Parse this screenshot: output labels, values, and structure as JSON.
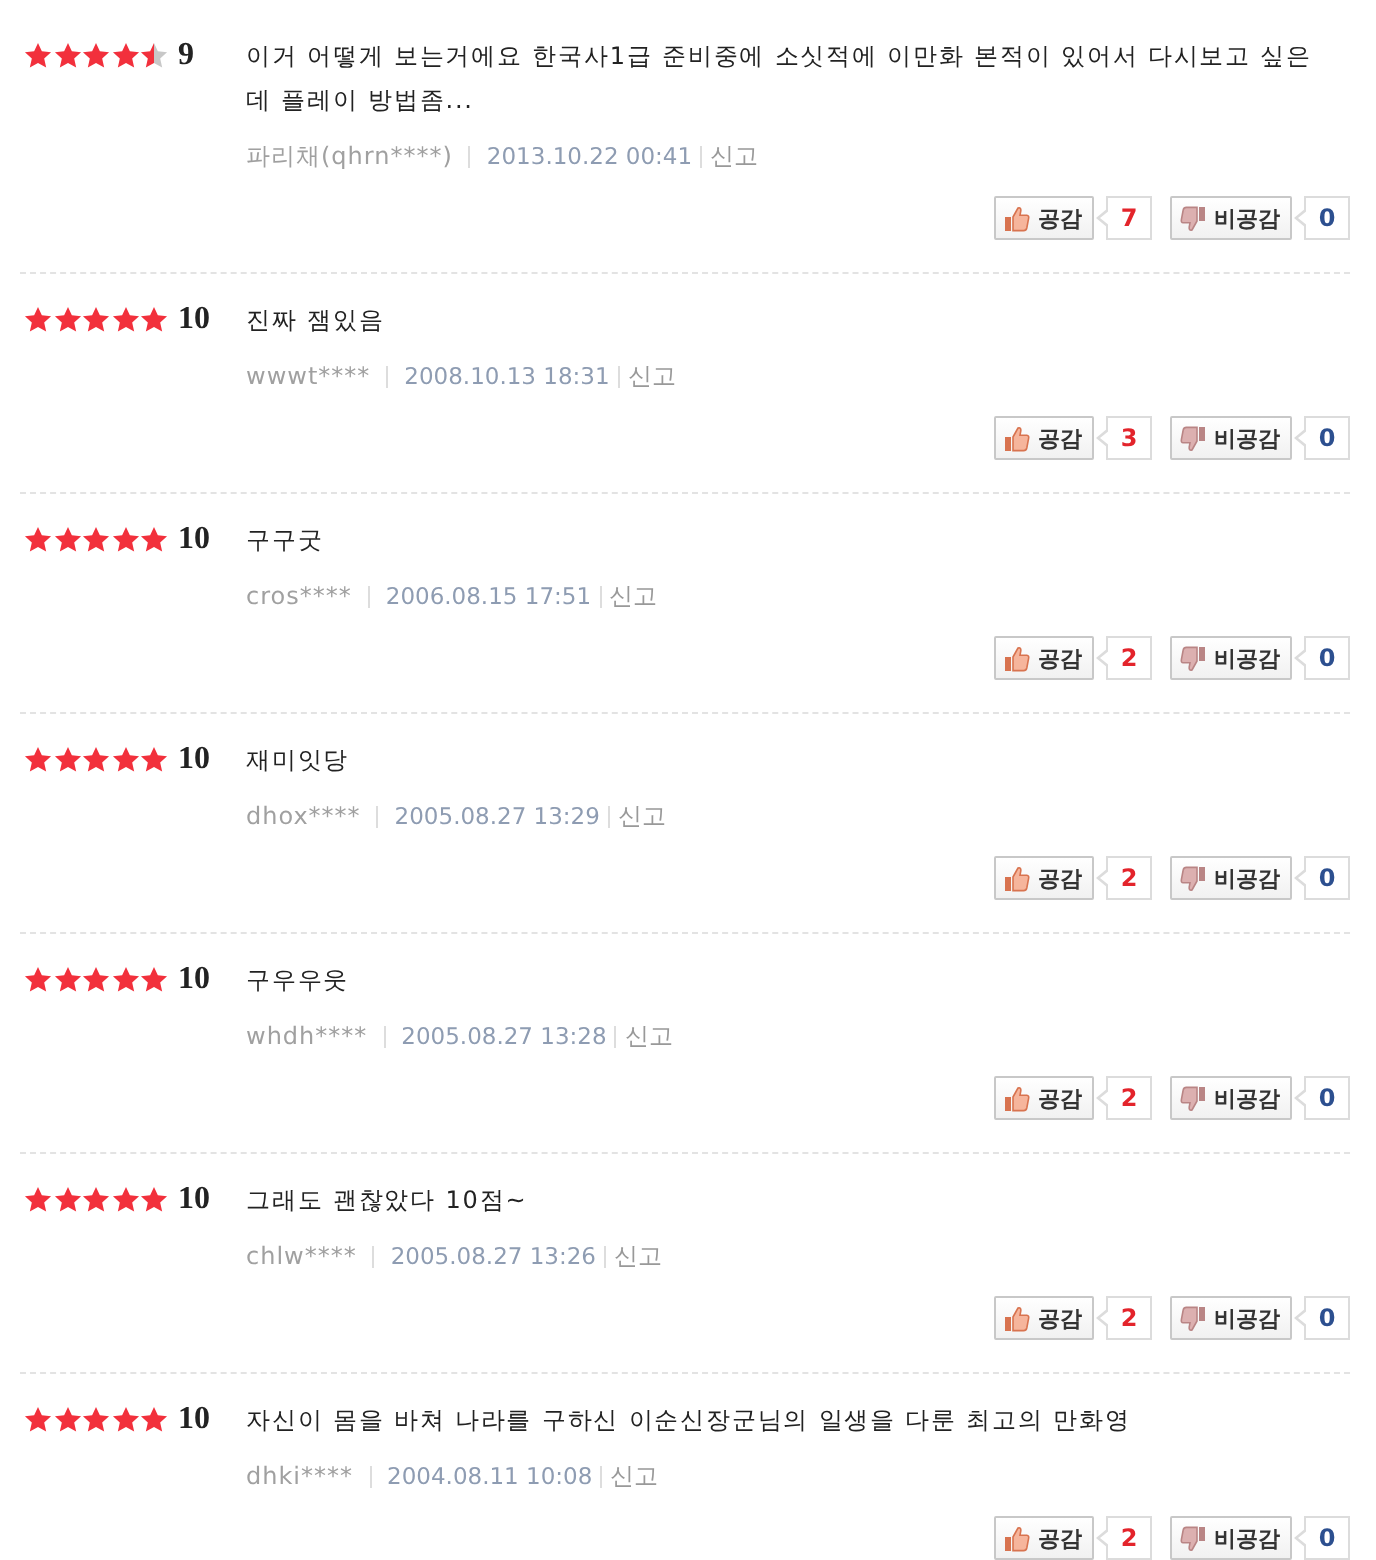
{
  "reviews": [
    {
      "stars": 4.5,
      "score": "9",
      "text": "이거 어떻게 보는거에요 한국사1급 준비중에 소싯적에 이만화 본적이 있어서 다시보고 싶은데 플레이 방법좀...",
      "author": "파리채(qhrn****)",
      "date": "2013.10.22 00:41",
      "report": "신고",
      "like": {
        "label": "공감",
        "count": "7"
      },
      "dislike": {
        "label": "비공감",
        "count": "0"
      }
    },
    {
      "stars": 5,
      "score": "10",
      "text": "진짜 잼있음",
      "author": "wwwt****",
      "date": "2008.10.13 18:31",
      "report": "신고",
      "like": {
        "label": "공감",
        "count": "3"
      },
      "dislike": {
        "label": "비공감",
        "count": "0"
      }
    },
    {
      "stars": 5,
      "score": "10",
      "text": "구구굿",
      "author": "cros****",
      "date": "2006.08.15 17:51",
      "report": "신고",
      "like": {
        "label": "공감",
        "count": "2"
      },
      "dislike": {
        "label": "비공감",
        "count": "0"
      }
    },
    {
      "stars": 5,
      "score": "10",
      "text": "재미잇당",
      "author": "dhox****",
      "date": "2005.08.27 13:29",
      "report": "신고",
      "like": {
        "label": "공감",
        "count": "2"
      },
      "dislike": {
        "label": "비공감",
        "count": "0"
      }
    },
    {
      "stars": 5,
      "score": "10",
      "text": "구우우웃",
      "author": "whdh****",
      "date": "2005.08.27 13:28",
      "report": "신고",
      "like": {
        "label": "공감",
        "count": "2"
      },
      "dislike": {
        "label": "비공감",
        "count": "0"
      }
    },
    {
      "stars": 5,
      "score": "10",
      "text": "그래도 괜찮았다 10점~",
      "author": "chlw****",
      "date": "2005.08.27 13:26",
      "report": "신고",
      "like": {
        "label": "공감",
        "count": "2"
      },
      "dislike": {
        "label": "비공감",
        "count": "0"
      }
    },
    {
      "stars": 5,
      "score": "10",
      "text": "자신이 몸을 바쳐 나라를 구하신 이순신장군님의 일생을 다룬 최고의 만화영",
      "author": "dhki****",
      "date": "2004.08.11 10:08",
      "report": "신고",
      "like": {
        "label": "공감",
        "count": "2"
      },
      "dislike": {
        "label": "비공감",
        "count": "0"
      }
    }
  ]
}
